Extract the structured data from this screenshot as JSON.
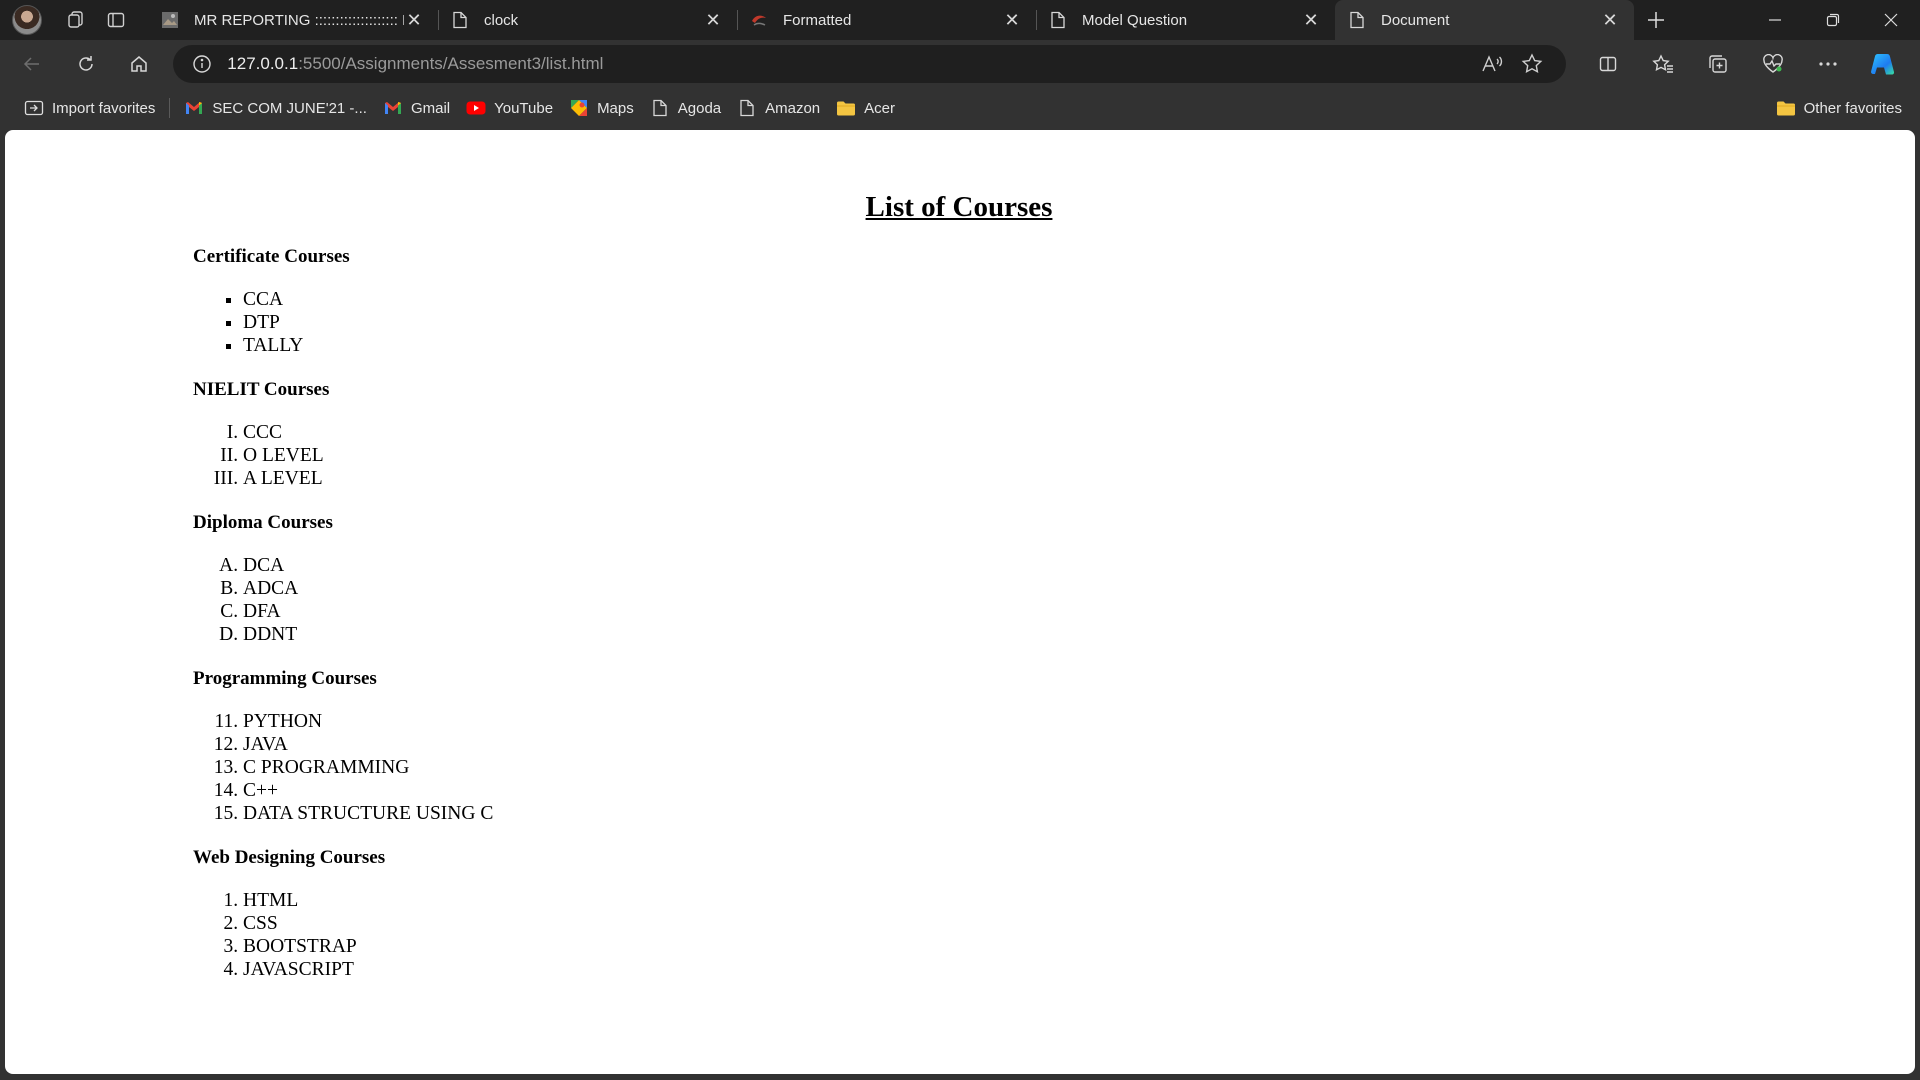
{
  "browser": {
    "tabs": [
      {
        "title": "MR REPORTING :::::::::::::::::::: PROCE",
        "favicon": "image-thumbnail-icon",
        "active": false
      },
      {
        "title": "clock",
        "favicon": "document-icon",
        "active": false
      },
      {
        "title": "Formatted",
        "favicon": "brand-logo-icon",
        "active": false
      },
      {
        "title": "Model Question",
        "favicon": "document-icon",
        "active": false
      },
      {
        "title": "Document",
        "favicon": "document-icon",
        "active": true
      }
    ],
    "address": {
      "host": "127.0.0.1",
      "path": ":5500/Assignments/Assesment3/list.html"
    },
    "favorites": [
      {
        "label": "Import favorites",
        "icon": "import-icon"
      },
      {
        "label": "SEC COM JUNE'21 -...",
        "icon": "gmail-icon"
      },
      {
        "label": "Gmail",
        "icon": "gmail-icon"
      },
      {
        "label": "YouTube",
        "icon": "youtube-icon"
      },
      {
        "label": "Maps",
        "icon": "maps-icon"
      },
      {
        "label": "Agoda",
        "icon": "document-icon"
      },
      {
        "label": "Amazon",
        "icon": "document-icon"
      },
      {
        "label": "Acer",
        "icon": "folder-icon"
      }
    ],
    "other_favorites": "Other favorites"
  },
  "page": {
    "heading": "List of Courses",
    "sections": [
      {
        "title": "Certificate Courses",
        "list_type": "square",
        "items": [
          "CCA",
          "DTP",
          "TALLY"
        ]
      },
      {
        "title": "NIELIT Courses",
        "list_type": "upper-roman",
        "items": [
          "CCC",
          "O LEVEL",
          "A LEVEL"
        ]
      },
      {
        "title": "Diploma Courses",
        "list_type": "upper-alpha",
        "items": [
          "DCA",
          "ADCA",
          "DFA",
          "DDNT"
        ]
      },
      {
        "title": "Programming Courses",
        "list_type": "decimal",
        "start": 11,
        "items": [
          "PYTHON",
          "JAVA",
          "C PROGRAMMING",
          "C++",
          "DATA STRUCTURE USING C"
        ]
      },
      {
        "title": "Web Designing Courses",
        "list_type": "decimal",
        "items": [
          "HTML",
          "CSS",
          "BOOTSTRAP",
          "JAVASCRIPT"
        ]
      }
    ]
  }
}
